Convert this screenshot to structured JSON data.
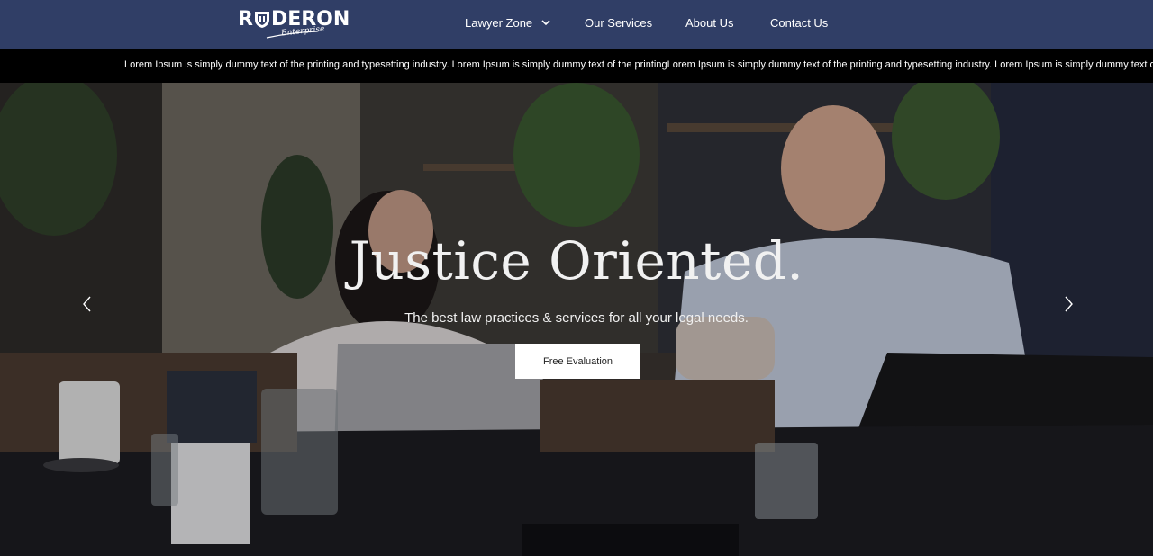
{
  "brand": {
    "name_left": "R",
    "name_right": "DERON",
    "tagline": "Enterprise"
  },
  "nav": {
    "items": [
      {
        "label": "Lawyer Zone",
        "has_dropdown": true
      },
      {
        "label": "Our Services"
      },
      {
        "label": "About Us"
      },
      {
        "label": "Contact Us"
      }
    ]
  },
  "ticker": {
    "text": "Lorem Ipsum is simply dummy text of the printing and typesetting industry. Lorem Ipsum is simply dummy text of the printingLorem Ipsum is simply dummy text of the printing and typesetting industry. Lorem Ipsum is simply dummy text of the printing"
  },
  "hero": {
    "title": "Justice Oriented.",
    "subtitle": "The best law practices & services for all your legal needs.",
    "cta_label": "Free Evaluation",
    "prev_icon": "chevron-left-icon",
    "next_icon": "chevron-right-icon"
  },
  "colors": {
    "header_bg": "#303e66",
    "ticker_bg": "#000000",
    "cta_bg": "#ffffff"
  }
}
